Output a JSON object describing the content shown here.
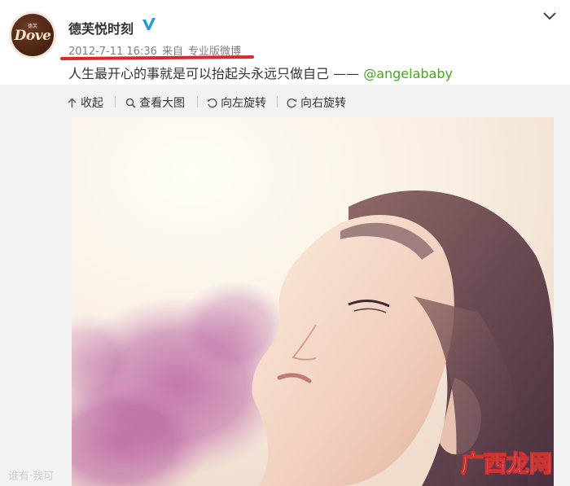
{
  "user": {
    "name": "德芙悦时刻",
    "avatar_brand": "Dove",
    "avatar_sub": "德芙"
  },
  "meta": {
    "datetime": "2012-7-11 16:36",
    "source_prefix": "来自",
    "source": "专业版微博"
  },
  "post": {
    "text": "人生最开心的事就是可以抬起头永远只做自己 —— ",
    "mention": "@angelababy"
  },
  "toolbar": {
    "collapse": "收起",
    "view_large": "查看大图",
    "rotate_left": "向左旋转",
    "rotate_right": "向右旋转"
  },
  "watermark": {
    "left_text": "谁有·我可"
  },
  "brand_mark": "广西龙网",
  "colors": {
    "accent_red": "#e0262c",
    "mention_green": "#4aa51f",
    "verified_blue": "#2a9ad6"
  },
  "icons": [
    "verified-icon",
    "chevron-down-icon",
    "collapse-up-icon",
    "magnify-icon",
    "rotate-left-icon",
    "rotate-right-icon"
  ]
}
